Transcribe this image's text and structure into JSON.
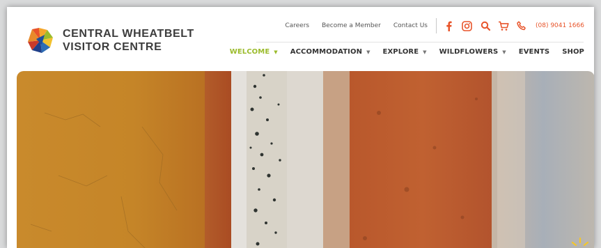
{
  "brand": {
    "name_line1": "CENTRAL WHEATBELT",
    "name_line2": "VISITOR CENTRE"
  },
  "utility_nav": {
    "links": [
      "Careers",
      "Become a Member",
      "Contact Us"
    ],
    "icons": [
      "facebook-icon",
      "instagram-icon",
      "search-icon",
      "cart-icon",
      "phone-icon"
    ],
    "phone": "(08) 9041 1666"
  },
  "main_nav": [
    {
      "label": "WELCOME",
      "dropdown": true,
      "active": true
    },
    {
      "label": "ACCOMMODATION",
      "dropdown": true,
      "active": false
    },
    {
      "label": "EXPLORE",
      "dropdown": true,
      "active": false
    },
    {
      "label": "WILDFLOWERS",
      "dropdown": true,
      "active": false
    },
    {
      "label": "EVENTS",
      "dropdown": false,
      "active": false
    },
    {
      "label": "SHOP",
      "dropdown": false,
      "active": false
    }
  ],
  "colors": {
    "accent_orange": "#e8542a",
    "accent_green": "#9bbb2b",
    "text_dark": "#333333"
  }
}
